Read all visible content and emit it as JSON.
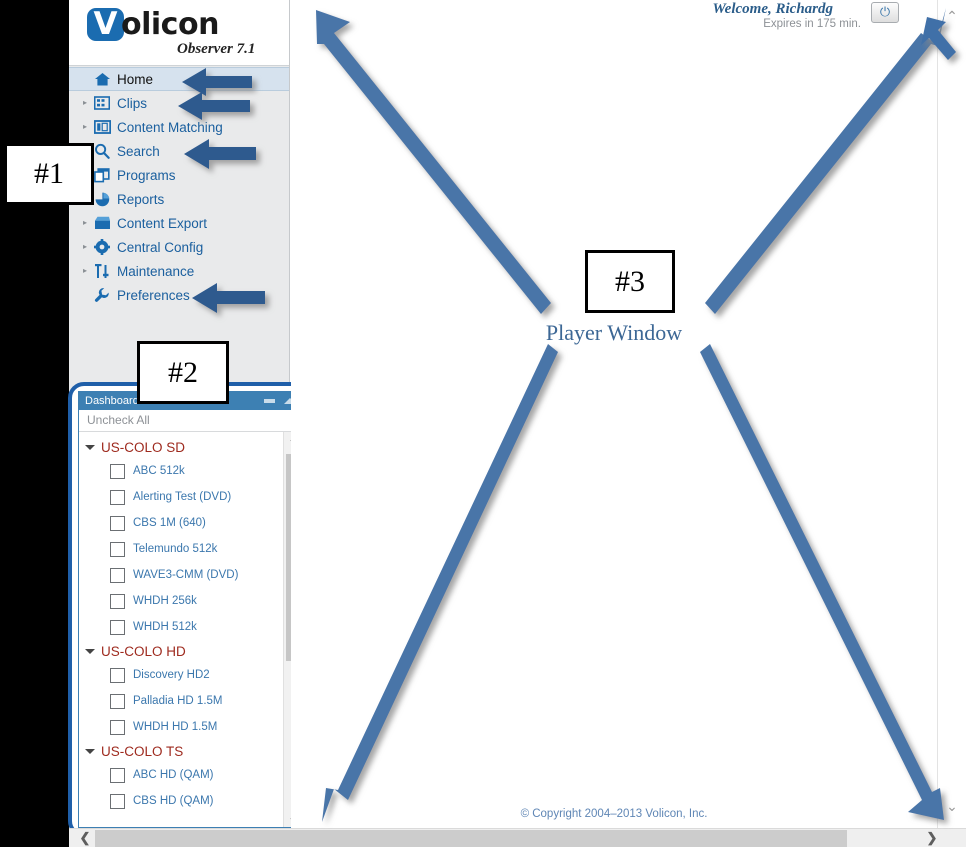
{
  "app": {
    "brand_name": "Volicon",
    "brand_initial": "V",
    "brand_rest": "olicon",
    "product_version": "Observer 7.1",
    "accent_blue": "#1b6cb0",
    "link_blue": "#1a5f9e",
    "group_red": "#9e2a1e",
    "arrow_blue": "#3f6fa8"
  },
  "header": {
    "welcome_text": "Welcome, Richardg",
    "expires_text": "Expires in 175 min.",
    "power_icon": "power-icon",
    "power_glyph": "⏻"
  },
  "sidebar": {
    "items": [
      {
        "label": "Home",
        "icon": "home-icon",
        "glyph": "⌂",
        "expandable": false,
        "active": true
      },
      {
        "label": "Clips",
        "icon": "film-strip-icon",
        "glyph": "▦",
        "expandable": true,
        "active": false
      },
      {
        "label": "Content Matching",
        "icon": "panels-icon",
        "glyph": "▥",
        "expandable": true,
        "active": false
      },
      {
        "label": "Search",
        "icon": "search-icon",
        "glyph": "⌕",
        "expandable": false,
        "active": false
      },
      {
        "label": "Programs",
        "icon": "programs-icon",
        "glyph": "❐",
        "expandable": false,
        "active": false
      },
      {
        "label": "Reports",
        "icon": "pie-chart-icon",
        "glyph": "◕",
        "expandable": true,
        "active": false
      },
      {
        "label": "Content Export",
        "icon": "export-clapper-icon",
        "glyph": "▤",
        "expandable": true,
        "active": false
      },
      {
        "label": "Central Config",
        "icon": "gear-icon",
        "glyph": "✿",
        "expandable": true,
        "active": false
      },
      {
        "label": "Maintenance",
        "icon": "sliders-icon",
        "glyph": "⇅",
        "expandable": true,
        "active": false
      },
      {
        "label": "Preferences",
        "icon": "wrench-icon",
        "glyph": "🔧",
        "expandable": false,
        "active": false
      }
    ]
  },
  "dashboard": {
    "title": "Dashboard",
    "minimize_icon": "minimize-icon",
    "collapse_icon": "collapse-up-icon",
    "uncheck_all_label": "Uncheck All",
    "scroll_up_icon": "chevron-up-icon",
    "scroll_down_icon": "chevron-down-icon",
    "groups": [
      {
        "name": "US-COLO SD",
        "expanded": true,
        "channels": [
          {
            "label": "ABC 512k",
            "checked": false
          },
          {
            "label": "Alerting Test (DVD)",
            "checked": false
          },
          {
            "label": "CBS 1M (640)",
            "checked": false
          },
          {
            "label": "Telemundo 512k",
            "checked": false
          },
          {
            "label": "WAVE3-CMM (DVD)",
            "checked": false
          },
          {
            "label": "WHDH 256k",
            "checked": false
          },
          {
            "label": "WHDH 512k",
            "checked": false
          }
        ]
      },
      {
        "name": "US-COLO HD",
        "expanded": true,
        "channels": [
          {
            "label": "Discovery HD2",
            "checked": false
          },
          {
            "label": "Palladia HD 1.5M",
            "checked": false
          },
          {
            "label": "WHDH HD 1.5M",
            "checked": false
          }
        ]
      },
      {
        "name": "US-COLO TS",
        "expanded": true,
        "channels": [
          {
            "label": "ABC HD (QAM)",
            "checked": false
          },
          {
            "label": "CBS HD (QAM)",
            "checked": false
          }
        ]
      }
    ]
  },
  "main": {
    "player_window_label": "Player Window",
    "copyright": "© Copyright 2004–2013 Volicon, Inc."
  },
  "callouts": [
    {
      "id": "1",
      "label": "#1"
    },
    {
      "id": "2",
      "label": "#2"
    },
    {
      "id": "3",
      "label": "#3"
    }
  ],
  "scrollbars": {
    "vertical_up_icon": "chevron-up-icon",
    "vertical_down_icon": "chevron-down-icon",
    "horizontal_left_icon": "chevron-left-icon",
    "horizontal_right_icon": "chevron-right-icon"
  }
}
